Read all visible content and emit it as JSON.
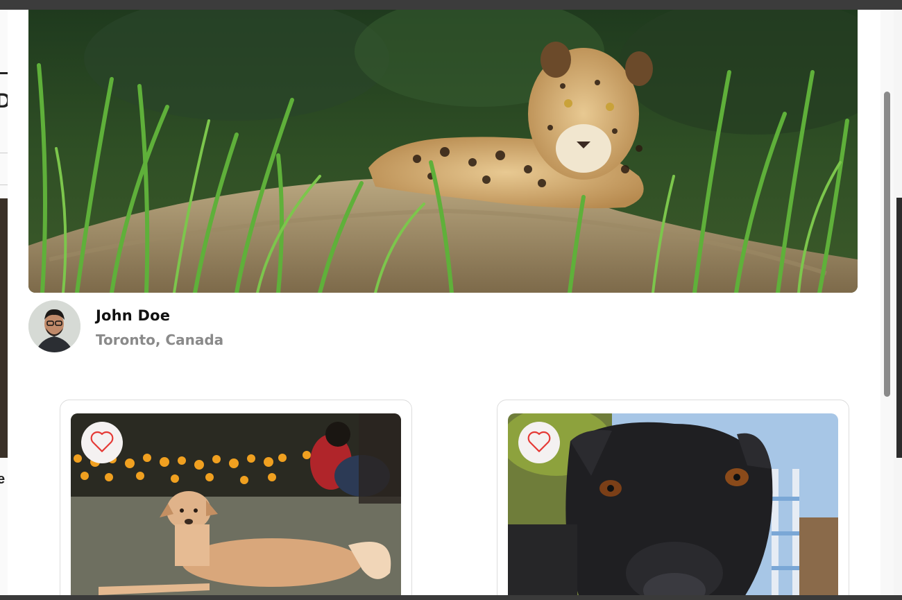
{
  "profile": {
    "name": "John Doe",
    "location": "Toronto, Canada"
  },
  "hero": {
    "subject": "jaguar-lying-in-grass"
  },
  "cards": [
    {
      "subject": "tan-dog-lying-on-grass",
      "like_icon": "heart-outline-icon"
    },
    {
      "subject": "black-dog-closeup",
      "like_icon": "heart-outline-icon"
    }
  ],
  "colors": {
    "heart": "#e53935",
    "location_text": "#8a8a8a",
    "name_text": "#111111"
  },
  "backdrop": {
    "left_glyph_top": "D",
    "left_glyph_bottom": "e"
  }
}
